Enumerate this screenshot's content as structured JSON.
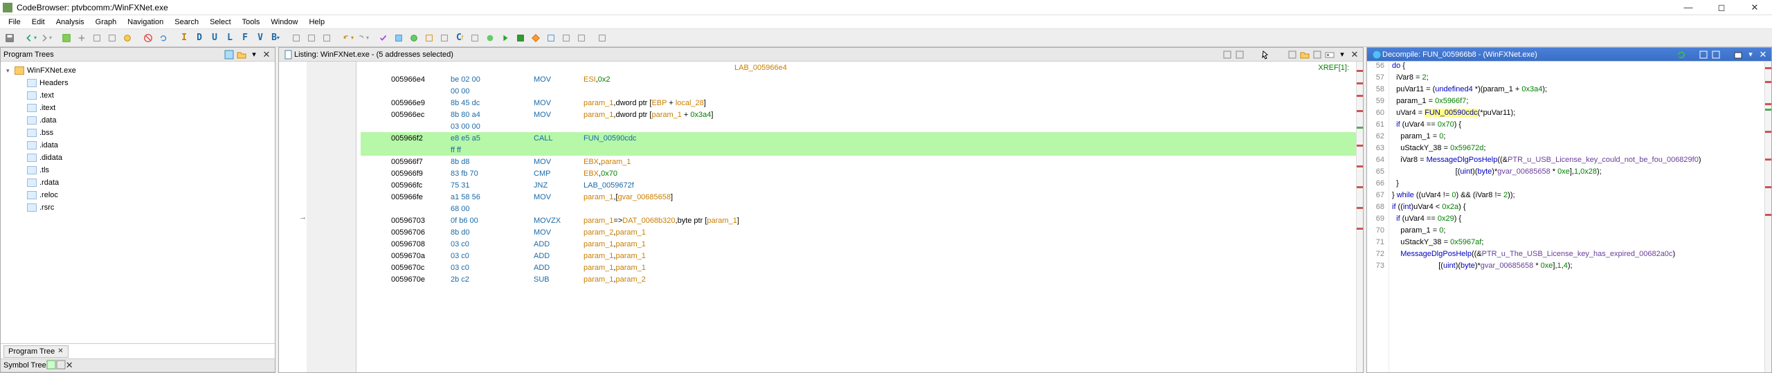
{
  "window": {
    "title": "CodeBrowser: ptvbcomm:/WinFXNet.exe"
  },
  "menu": [
    "File",
    "Edit",
    "Analysis",
    "Graph",
    "Navigation",
    "Search",
    "Select",
    "Tools",
    "Window",
    "Help"
  ],
  "toolbar_letters": [
    "I",
    "D",
    "U",
    "L",
    "F",
    "V",
    "B"
  ],
  "program_trees": {
    "title": "Program Trees",
    "root": "WinFXNet.exe",
    "nodes": [
      "Headers",
      ".text",
      ".itext",
      ".data",
      ".bss",
      ".idata",
      ".didata",
      ".tls",
      ".rdata",
      ".reloc",
      ".rsrc"
    ],
    "tab": "Program Tree"
  },
  "symbol_tree": {
    "title": "Symbol Tree"
  },
  "listing": {
    "title": "Listing: WinFXNet.exe - (5 addresses selected)",
    "xref": "XREF[1]:",
    "lab": "LAB_005966e4",
    "rows": [
      {
        "a": "005966e4",
        "b": "be 02 00",
        "m": "MOV",
        "o": "ESI,0x2"
      },
      {
        "a": "",
        "b": "00 00",
        "m": "",
        "o": ""
      },
      {
        "a": "005966e9",
        "b": "8b 45 dc",
        "m": "MOV",
        "o": "param_1,dword ptr [EBP + local_28]"
      },
      {
        "a": "005966ec",
        "b": "8b 80 a4",
        "m": "MOV",
        "o": "param_1,dword ptr [param_1 + 0x3a4]"
      },
      {
        "a": "",
        "b": "03 00 00",
        "m": "",
        "o": ""
      },
      {
        "a": "005966f2",
        "b": "e8 e5 a5",
        "m": "CALL",
        "o": "FUN_00590cdc",
        "hl": true
      },
      {
        "a": "",
        "b": "ff ff",
        "m": "",
        "o": "",
        "hl": true
      },
      {
        "a": "005966f7",
        "b": "8b d8",
        "m": "MOV",
        "o": "EBX,param_1"
      },
      {
        "a": "005966f9",
        "b": "83 fb 70",
        "m": "CMP",
        "o": "EBX,0x70"
      },
      {
        "a": "005966fc",
        "b": "75 31",
        "m": "JNZ",
        "o": "LAB_0059672f"
      },
      {
        "a": "005966fe",
        "b": "a1 58 56",
        "m": "MOV",
        "o": "param_1,[gvar_00685658]"
      },
      {
        "a": "",
        "b": "68 00",
        "m": "",
        "o": ""
      },
      {
        "a": "00596703",
        "b": "0f b6 00",
        "m": "MOVZX",
        "o": "param_1=>DAT_0068b320,byte ptr [param_1]"
      },
      {
        "a": "00596706",
        "b": "8b d0",
        "m": "MOV",
        "o": "param_2,param_1"
      },
      {
        "a": "00596708",
        "b": "03 c0",
        "m": "ADD",
        "o": "param_1,param_1"
      },
      {
        "a": "0059670a",
        "b": "03 c0",
        "m": "ADD",
        "o": "param_1,param_1"
      },
      {
        "a": "0059670c",
        "b": "03 c0",
        "m": "ADD",
        "o": "param_1,param_1"
      },
      {
        "a": "0059670e",
        "b": "2b c2",
        "m": "SUB",
        "o": "param_1,param_2"
      }
    ]
  },
  "decomp": {
    "title": "Decompile: FUN_005966b8 - (WinFXNet.exe)",
    "start": 56,
    "lines": [
      "do {",
      "  iVar8 = 2;",
      "  puVar11 = (undefined4 *)(param_1 + 0x3a4);",
      "  param_1 = 0x5966f7;",
      "  uVar4 = FUN_00590cdc(*puVar11);",
      "  if (uVar4 == 0x70) {",
      "    param_1 = 0;",
      "    uStackY_38 = 0x59672d;",
      "    iVar8 = MessageDlgPosHelp((&PTR_u_USB_License_key_could_not_be_fou_006829f0)",
      "                              [(uint)(byte)*gvar_00685658 * 0xe],1,0x28);",
      "  }",
      "} while ((uVar4 != 0) && (iVar8 != 2));",
      "if ((int)uVar4 < 0x2a) {",
      "  if (uVar4 == 0x29) {",
      "    param_1 = 0;",
      "    uStackY_38 = 0x5967af;",
      "    MessageDlgPosHelp((&PTR_u_The_USB_License_key_has_expired_00682a0c)",
      "                      [(uint)(byte)*gvar_00685658 * 0xe],1,4);"
    ]
  }
}
